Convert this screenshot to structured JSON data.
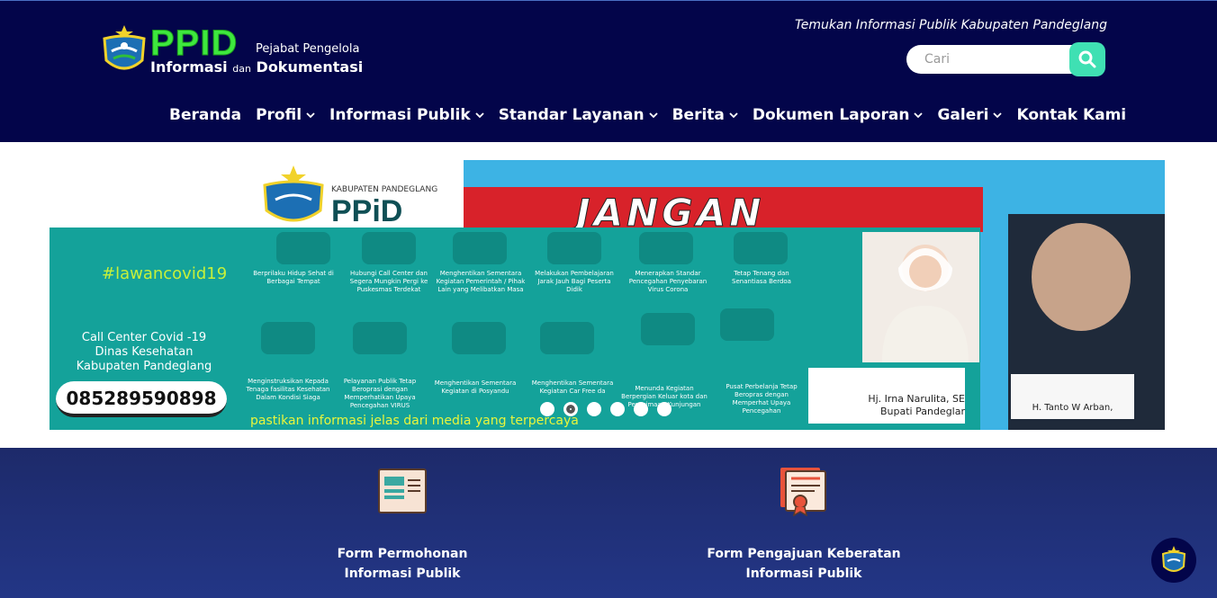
{
  "header": {
    "logo": {
      "brand": "PPID",
      "sub_line1": "Pejabat Pengelola",
      "sub_informasi": "Informasi",
      "sub_dan": "dan",
      "sub_dokumentasi": "Dokumentasi"
    },
    "tagline": "Temukan Informasi Publik Kabupaten Pandeglang",
    "search": {
      "placeholder": "Cari",
      "value": ""
    },
    "nav": [
      {
        "label": "Beranda",
        "has_dropdown": false
      },
      {
        "label": "Profil",
        "has_dropdown": true
      },
      {
        "label": "Informasi Publik",
        "has_dropdown": true
      },
      {
        "label": "Standar Layanan",
        "has_dropdown": true
      },
      {
        "label": "Berita",
        "has_dropdown": true
      },
      {
        "label": "Dokumen Laporan",
        "has_dropdown": true
      },
      {
        "label": "Galeri",
        "has_dropdown": true
      },
      {
        "label": "Kontak Kami",
        "has_dropdown": false
      }
    ]
  },
  "banner": {
    "kabupaten": "KABUPATEN PANDEGLANG",
    "ppid": "PPiD",
    "headline": "JANGAN",
    "hashtag": "#lawancovid19",
    "call_center_lines": [
      "Call Center Covid -19",
      "Dinas Kesehatan",
      "Kabupaten Pandeglang"
    ],
    "phone": "085289590898",
    "bottom_text": "pastikan informasi jelas dari media yang terpercaya",
    "tips_row1": [
      "Berprilaku Hidup Sehat di Berbagai Tempat",
      "Hubungi Call Center dan Segera Mungkin Pergi ke Puskesmas Terdekat",
      "Menghentikan Sementara Kegiatan Pemerintah / Pihak Lain yang Melibatkan Masa",
      "Melakukan Pembelajaran Jarak Jauh Bagi Peserta Didik",
      "Menerapkan Standar Pencegahan Penyebaran Virus Corona",
      "Tetap Tenang dan Senantiasa Berdoa"
    ],
    "tips_row2": [
      "Menginstruksikan Kepada Tenaga fasilitas Kesehatan Dalam Kondisi Siaga",
      "Pelayanan Publik Tetap Beroprasi dengan Memperhatikan Upaya Pencegahan VIRUS",
      "Menghentikan Sementara Kegiatan di Posyandu",
      "Menghentikan Sementara Kegiatan Car Free da",
      "Menunda Kegiatan Berpergian Keluar kota dan Penerimaan Kunjungan",
      "Pusat Perbelanja Tetap Beropras dengan Memperhat Upaya Pencegahan"
    ],
    "bupati_caption_line1": "Hj. Irna Narulita, SE",
    "bupati_caption_line2": "Bupati Pandeglar",
    "wakil_caption": "H. Tanto W Arban,",
    "slides_count": 6,
    "active_slide": 2
  },
  "cards": [
    {
      "line1": "Form Permohonan",
      "line2": "Informasi Publik",
      "icon": "form-document-icon"
    },
    {
      "line1": "Form Pengajuan Keberatan",
      "line2": "Informasi Publik",
      "icon": "certificate-icon"
    }
  ],
  "colors": {
    "header_bg": "#03054a",
    "accent_green": "#3ee83e",
    "search_button": "#3fe0b3",
    "bottom_bg": "#233686"
  }
}
